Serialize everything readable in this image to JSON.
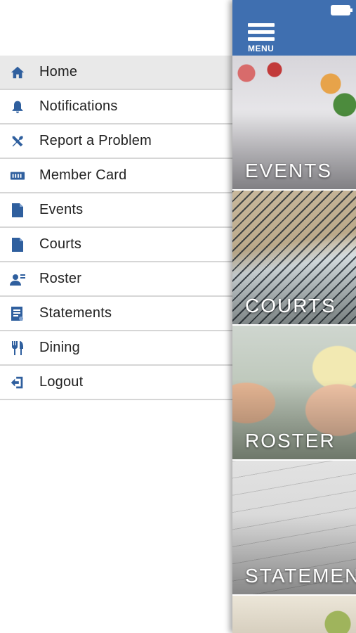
{
  "menu": {
    "items": [
      {
        "label": "Home",
        "icon": "home-icon",
        "active": true
      },
      {
        "label": "Notifications",
        "icon": "bell-icon"
      },
      {
        "label": "Report a Problem",
        "icon": "tools-icon"
      },
      {
        "label": "Member Card",
        "icon": "card-icon"
      },
      {
        "label": "Events",
        "icon": "document-icon"
      },
      {
        "label": "Courts",
        "icon": "document-icon"
      },
      {
        "label": "Roster",
        "icon": "roster-icon"
      },
      {
        "label": "Statements",
        "icon": "statement-icon"
      },
      {
        "label": "Dining",
        "icon": "dining-icon"
      },
      {
        "label": "Logout",
        "icon": "logout-icon"
      }
    ]
  },
  "panel": {
    "menu_button_label": "MENU",
    "tiles": [
      {
        "caption": "EVENTS"
      },
      {
        "caption": "COURTS"
      },
      {
        "caption": "ROSTER"
      },
      {
        "caption": "STATEMENTS"
      }
    ]
  },
  "colors": {
    "accent": "#3f6fb0",
    "icon": "#2f5f9e",
    "active_row": "#e9e9e9",
    "divider": "#d6d6d6"
  }
}
